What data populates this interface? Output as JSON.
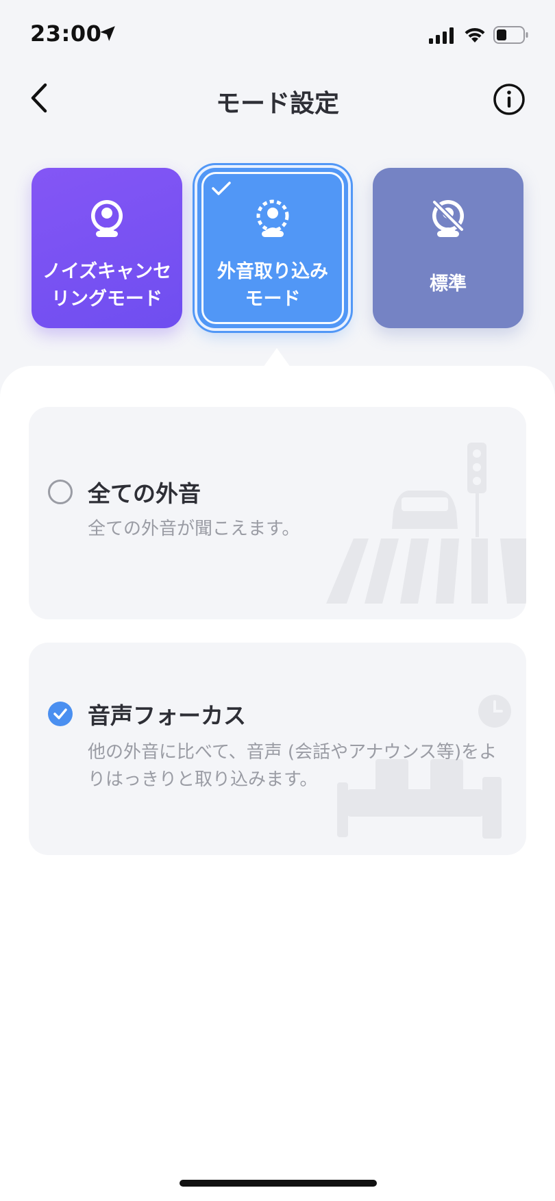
{
  "status_bar": {
    "time": "23:00",
    "icons": [
      "location-arrow-icon",
      "cellular-signal-icon",
      "wifi-icon",
      "battery-icon"
    ]
  },
  "header": {
    "title": "モード設定",
    "back_icon": "chevron-left-icon",
    "info_icon": "info-icon"
  },
  "modes": [
    {
      "label": "ノイズキャンセ\nリングモード",
      "icon": "noise-cancel-icon",
      "color": "#7b52f3",
      "selected": false
    },
    {
      "label": "外音取り込み\nモード",
      "icon": "ambient-sound-icon",
      "color": "#5197f6",
      "selected": true
    },
    {
      "label": "標準",
      "icon": "standard-mode-icon",
      "color": "#7583c4",
      "selected": false
    }
  ],
  "options": [
    {
      "title": "全ての外音",
      "description": "全ての外音が聞こえます。",
      "selected": false,
      "illustration": "street-crossing-illustration"
    },
    {
      "title": "音声フォーカス",
      "description": "他の外音に比べて、音声 (会話やアナウンス等)をよりはっきりと取り込みます。",
      "selected": true,
      "illustration": "waiting-room-illustration"
    }
  ],
  "colors": {
    "accent": "#4a8ff0",
    "background": "#f4f5f8",
    "panel": "#ffffff",
    "text_primary": "#2e2f36",
    "text_secondary": "#9a9ca4"
  }
}
